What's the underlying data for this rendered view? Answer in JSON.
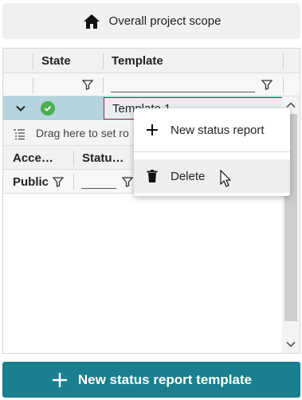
{
  "scope_button": {
    "label": "Overall project scope",
    "icon": "home-icon"
  },
  "grid": {
    "columns": {
      "state": "State",
      "template": "Template"
    },
    "rows": [
      {
        "state": "success",
        "template": "Template 1"
      }
    ],
    "group_hint": "Drag here to set ro",
    "sub_columns": {
      "access": "Acce…",
      "status": "Statu…"
    },
    "sub_filter": {
      "access_value": "Public"
    }
  },
  "context_menu": {
    "items": [
      {
        "label": "New status report",
        "icon": "plus-icon"
      },
      {
        "label": "Delete",
        "icon": "trash-icon"
      }
    ]
  },
  "primary_action": {
    "label": "New status report template",
    "icon": "plus-icon"
  },
  "colors": {
    "primary": "#1a7f8e",
    "selected_row": "#b4d4de",
    "status_ok": "#4caf50",
    "cell_border": "#a0284c"
  }
}
